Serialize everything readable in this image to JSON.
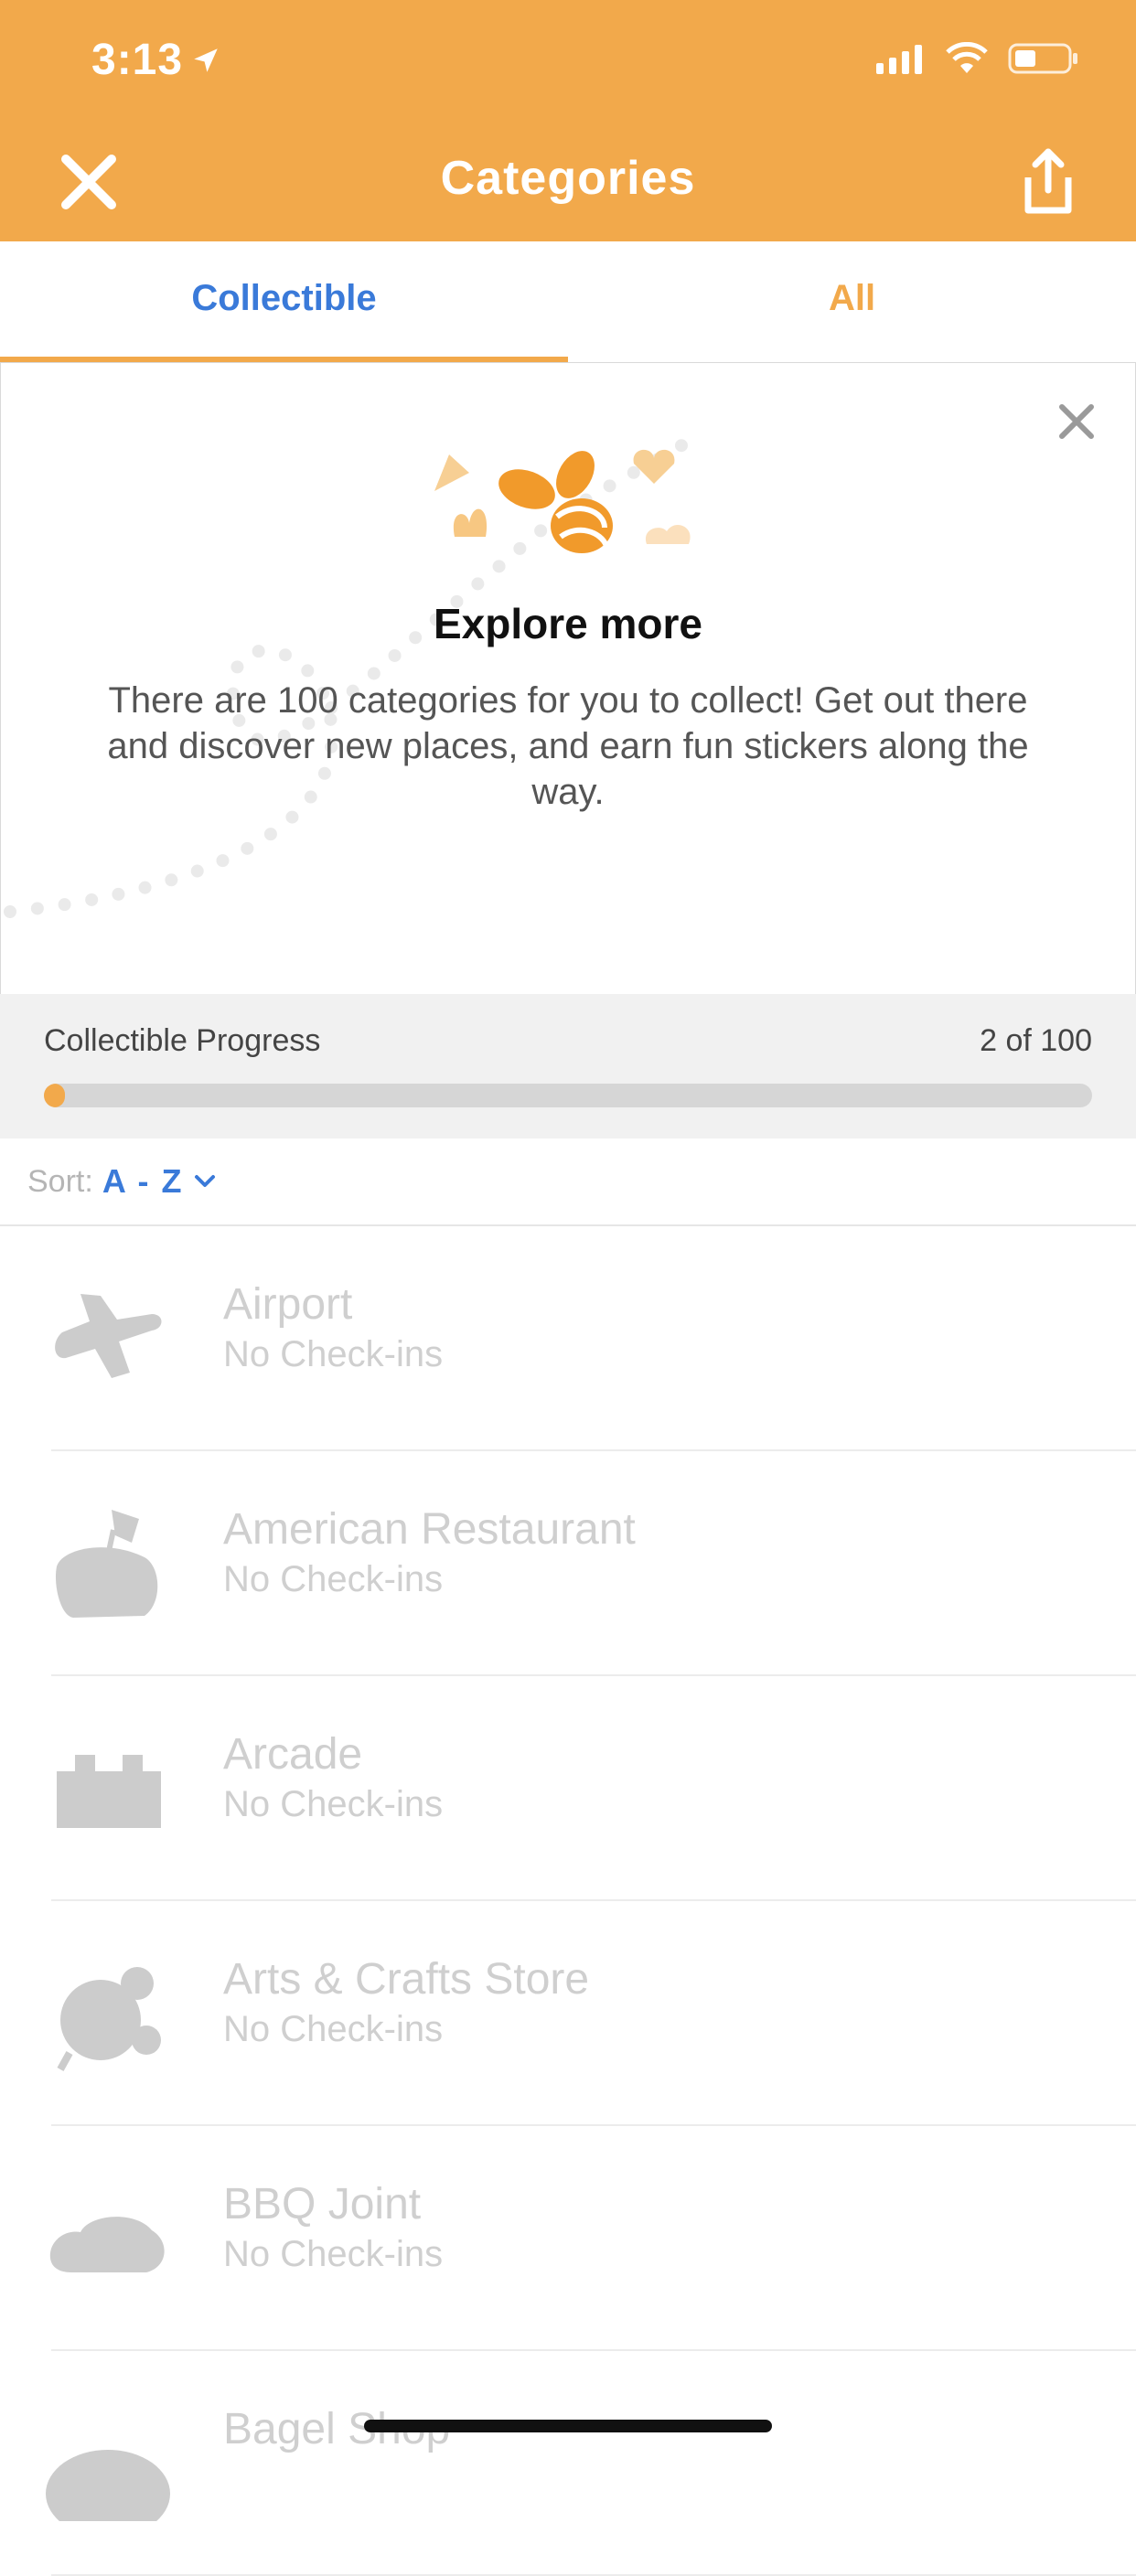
{
  "status_bar": {
    "time": "3:13"
  },
  "header": {
    "title": "Categories"
  },
  "tabs": [
    {
      "label": "Collectible",
      "active": true
    },
    {
      "label": "All",
      "active": false
    }
  ],
  "explore_card": {
    "title": "Explore more",
    "body": "There are 100 categories for you to collect! Get out there and discover new places, and earn fun stickers along the way."
  },
  "progress": {
    "label": "Collectible Progress",
    "count_text": "2 of 100",
    "fraction": 0.02
  },
  "sort": {
    "label": "Sort:",
    "value": "A - Z"
  },
  "categories": [
    {
      "name": "Airport",
      "checkins": "No Check-ins",
      "icon": "airplane-icon"
    },
    {
      "name": "American Restaurant",
      "checkins": "No Check-ins",
      "icon": "burger-flag-icon"
    },
    {
      "name": "Arcade",
      "checkins": "No Check-ins",
      "icon": "arcade-icon"
    },
    {
      "name": "Arts & Crafts Store",
      "checkins": "No Check-ins",
      "icon": "craft-icon"
    },
    {
      "name": "BBQ Joint",
      "checkins": "No Check-ins",
      "icon": "bbq-icon"
    },
    {
      "name": "Bagel Shop",
      "checkins": "",
      "icon": "bagel-icon"
    }
  ],
  "colors": {
    "brand_orange": "#f2a94b",
    "link_blue": "#3a7ad9",
    "disabled_gray": "#cfcfcf"
  }
}
